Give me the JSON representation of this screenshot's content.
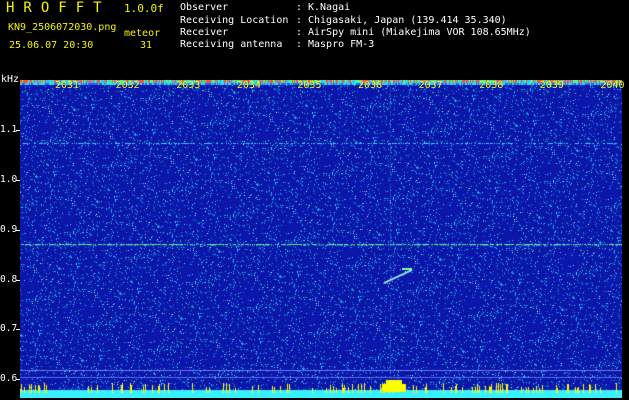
{
  "header": {
    "brand": "HROFFT",
    "version": "1.0.0f",
    "filename": "KN9_2506072030.png",
    "datetime": "25.06.07 20:30",
    "meteor_label": "meteor",
    "meteor_count": "31"
  },
  "info": [
    {
      "key": "Observer",
      "value": "K.Nagai"
    },
    {
      "key": "Receiving Location",
      "value": "Chigasaki, Japan (139.414 35.340)"
    },
    {
      "key": "Receiver",
      "value": "AirSpy mini (Miakejima VOR 108.65MHz)"
    },
    {
      "key": "Receiving antenna",
      "value": "Maspro FM-3"
    }
  ],
  "axis": {
    "unit": "kHz",
    "y_ticks": [
      "1.1",
      "1.0",
      "0.9",
      "0.8",
      "0.7",
      "0.6"
    ],
    "x_ticks": [
      "2031",
      "2032",
      "2033",
      "2034",
      "2035",
      "2036",
      "2037",
      "2038",
      "2039",
      "2040"
    ]
  },
  "colors": {
    "label_yellow": "#f4f400",
    "background_blue": "#101aa0",
    "noise_cyan": "#2fe0ff",
    "baseline_cyan": "#38f0ff",
    "baseline_yellow": "#ffff00"
  }
}
